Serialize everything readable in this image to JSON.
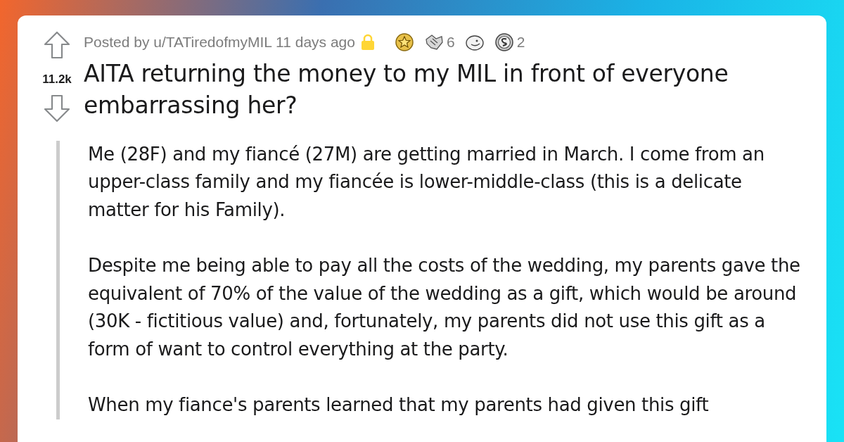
{
  "post": {
    "score": "11.2k",
    "meta": "Posted by u/TATiredofmyMIL 11 days ago",
    "locked": true,
    "awards": [
      {
        "kind": "star"
      },
      {
        "kind": "hands",
        "count": "6"
      },
      {
        "kind": "face"
      },
      {
        "kind": "coin",
        "count": "2"
      }
    ],
    "title": "AITA returning the money to my MIL in front of everyone embarrassing her?",
    "paragraphs": [
      "Me (28F) and my fiancé (27M) are getting married in March. I come from an upper-class family and my fiancée is lower-middle-class (this is a delicate matter for his Family).",
      "Despite me being able to pay all the costs of the wedding, my parents gave the equivalent of 70% of the value of the wedding as a gift, which would be around (30K - fictitious value) and, fortunately, my parents did not use this gift as a form of want to control everything at the party.",
      "When my fiance's parents learned that my parents had given this gift"
    ]
  }
}
